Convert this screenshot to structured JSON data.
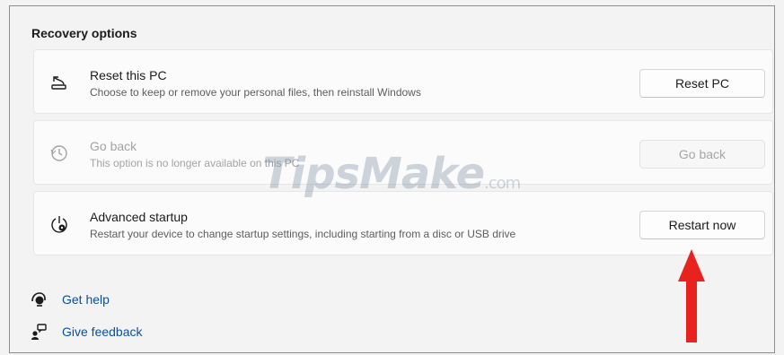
{
  "section": {
    "title": "Recovery options"
  },
  "cards": [
    {
      "title": "Reset this PC",
      "description": "Choose to keep or remove your personal files, then reinstall Windows",
      "button": "Reset PC",
      "icon": "reset-pc-icon",
      "enabled": true
    },
    {
      "title": "Go back",
      "description": "This option is no longer available on this PC",
      "button": "Go back",
      "icon": "history-icon",
      "enabled": false
    },
    {
      "title": "Advanced startup",
      "description": "Restart your device to change startup settings, including starting from a disc or USB drive",
      "button": "Restart now",
      "icon": "advanced-startup-icon",
      "enabled": true
    }
  ],
  "links": [
    {
      "label": "Get help",
      "icon": "get-help-icon"
    },
    {
      "label": "Give feedback",
      "icon": "feedback-icon"
    }
  ],
  "watermark": {
    "main": "TipsMake",
    "suffix": ".com"
  },
  "colors": {
    "link": "#0a4f9c",
    "annotation_arrow": "#e8231d"
  }
}
